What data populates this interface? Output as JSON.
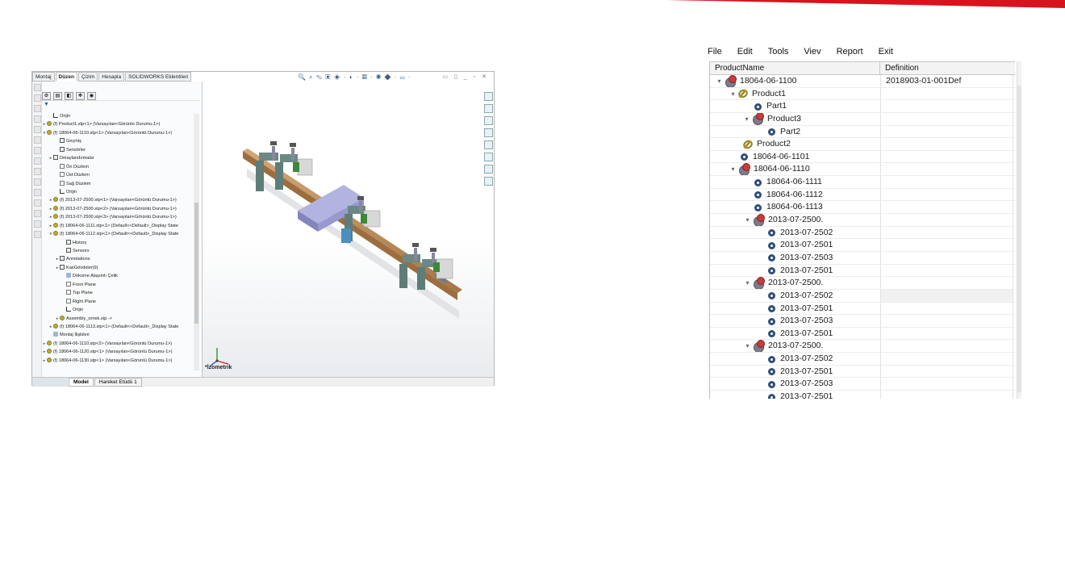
{
  "brand": {
    "accent_color": "#d7141e"
  },
  "solidworks": {
    "command_tabs": [
      "Montaj",
      "Düzen",
      "Çizim",
      "Hesapla",
      "SOLIDWORKS Eklentileri"
    ],
    "active_tab": "Düzen",
    "feature_tree": [
      {
        "text": "Orijin",
        "indent": 1,
        "icon": "origin",
        "arrow": ""
      },
      {
        "text": "(f) Product1.stp<1> (Varsayılan<Görüntü Durumu-1>)",
        "indent": 0,
        "icon": "assy",
        "arrow": "▸"
      },
      {
        "text": "(f) 18064-06-1110.stp<1> (Varsayılan<Görüntü Durumu-1>)",
        "indent": 0,
        "icon": "assy",
        "arrow": "▾"
      },
      {
        "text": "Geçmiş",
        "indent": 2,
        "icon": "folder",
        "arrow": ""
      },
      {
        "text": "Sensörler",
        "indent": 2,
        "icon": "folder",
        "arrow": ""
      },
      {
        "text": "Detaylandırmalar",
        "indent": 1,
        "icon": "folder",
        "arrow": "▸"
      },
      {
        "text": "Ön Düzlem",
        "indent": 2,
        "icon": "plane",
        "arrow": ""
      },
      {
        "text": "Üst Düzlem",
        "indent": 2,
        "icon": "plane",
        "arrow": ""
      },
      {
        "text": "Sağ Düzlem",
        "indent": 2,
        "icon": "plane",
        "arrow": ""
      },
      {
        "text": "Orijin",
        "indent": 2,
        "icon": "origin",
        "arrow": ""
      },
      {
        "text": "(f) 2013-07-2500.stp<1> (Varsayılan<Görüntü Durumu-1>)",
        "indent": 1,
        "icon": "assy",
        "arrow": "▸"
      },
      {
        "text": "(f) 2013-07-2500.stp<2> (Varsayılan<Görüntü Durumu-1>)",
        "indent": 1,
        "icon": "assy",
        "arrow": "▸"
      },
      {
        "text": "(f) 2013-07-2500.stp<3> (Varsayılan<Görüntü Durumu-1>)",
        "indent": 1,
        "icon": "assy",
        "arrow": "▸"
      },
      {
        "text": "(f) 18064-06-1111.stp<1> (Default<<Default>_Display State",
        "indent": 1,
        "icon": "assy",
        "arrow": "▸"
      },
      {
        "text": "(f) 18064-06-1112.stp<1> (Default<<Default>_Display State",
        "indent": 1,
        "icon": "assy",
        "arrow": "▾"
      },
      {
        "text": "History",
        "indent": 3,
        "icon": "folder",
        "arrow": ""
      },
      {
        "text": "Sensors",
        "indent": 3,
        "icon": "folder",
        "arrow": ""
      },
      {
        "text": "Annotations",
        "indent": 2,
        "icon": "folder",
        "arrow": "▸"
      },
      {
        "text": "KatıGövdeler(9)",
        "indent": 2,
        "icon": "folder",
        "arrow": "▸"
      },
      {
        "text": "Döküme Alaşımlı Çelik",
        "indent": 3,
        "icon": "mate",
        "arrow": ""
      },
      {
        "text": "Front Plane",
        "indent": 3,
        "icon": "plane",
        "arrow": ""
      },
      {
        "text": "Top Plane",
        "indent": 3,
        "icon": "plane",
        "arrow": ""
      },
      {
        "text": "Right Plane",
        "indent": 3,
        "icon": "plane",
        "arrow": ""
      },
      {
        "text": "Orijin",
        "indent": 3,
        "icon": "origin",
        "arrow": ""
      },
      {
        "text": "Assembly_ornek.stp ->",
        "indent": 2,
        "icon": "assy",
        "arrow": "▸"
      },
      {
        "text": "(f) 18064-06-1113.stp<1> (Default<<Default>_Display State",
        "indent": 1,
        "icon": "assy",
        "arrow": "▸"
      },
      {
        "text": "Montaj İlişkileri",
        "indent": 1,
        "icon": "mate",
        "arrow": ""
      },
      {
        "text": "(f) 18064-06-1110.stp<2> (Varsayılan<Görüntü Durumu-1>)",
        "indent": 0,
        "icon": "assy",
        "arrow": "▸"
      },
      {
        "text": "(f) 18064-06-1120.stp<1> (Varsayılan<Görüntü Durumu-1>)",
        "indent": 0,
        "icon": "assy",
        "arrow": "▸"
      },
      {
        "text": "(f) 18064-06-1130.stp<1> (Varsayılan<Görüntü Durumu-1>)",
        "indent": 0,
        "icon": "assy",
        "arrow": "▸"
      }
    ],
    "bottom_tabs": [
      "Model",
      "Hareket Etüdü 1"
    ],
    "view_orientation": "*İzometrik",
    "colors": {
      "rail": "#b98a55",
      "clamp": "#5f7d78",
      "plate": "#9a9ad2",
      "handle": "#3a8a3a"
    }
  },
  "product_tree": {
    "menu": [
      "File",
      "Edit",
      "Tools",
      "Viev",
      "Report",
      "Exit"
    ],
    "columns": [
      "ProductName",
      "Definition"
    ],
    "rows": [
      {
        "name": "18064-06-1100",
        "definition": "2018903-01-001Def",
        "level": 0,
        "icon": "assy",
        "expand": "▾"
      },
      {
        "name": "Product1",
        "definition": "",
        "level": 1,
        "icon": "prod",
        "expand": "▾"
      },
      {
        "name": "Part1",
        "definition": "",
        "level": 2,
        "icon": "part",
        "expand": ""
      },
      {
        "name": "Product3",
        "definition": "",
        "level": 2,
        "icon": "assy",
        "expand": "▾"
      },
      {
        "name": "Part2",
        "definition": "",
        "level": 3,
        "icon": "part",
        "expand": ""
      },
      {
        "name": "Product2",
        "definition": "",
        "level": 2,
        "icon": "prod",
        "expand": ""
      },
      {
        "name": "18064-06-1101",
        "definition": "",
        "level": 1,
        "icon": "part",
        "expand": ""
      },
      {
        "name": "18064-06-1110",
        "definition": "",
        "level": 0,
        "icon": "assy",
        "expand": "▾",
        "pad": "tight"
      },
      {
        "name": "18064-06-1111",
        "definition": "",
        "level": 2,
        "icon": "part",
        "expand": ""
      },
      {
        "name": "18064-06-1112",
        "definition": "",
        "level": 2,
        "icon": "part",
        "expand": ""
      },
      {
        "name": "18064-06-1113",
        "definition": "",
        "level": 2,
        "icon": "part",
        "expand": ""
      },
      {
        "name": "2013-07-2500.",
        "definition": "",
        "level": 2,
        "icon": "assy",
        "expand": "▾",
        "group": true
      },
      {
        "name": "2013-07-2502",
        "definition": "",
        "level": 3,
        "icon": "part",
        "expand": ""
      },
      {
        "name": "2013-07-2501",
        "definition": "",
        "level": 3,
        "icon": "part",
        "expand": ""
      },
      {
        "name": "2013-07-2503",
        "definition": "",
        "level": 3,
        "icon": "part",
        "expand": ""
      },
      {
        "name": "2013-07-2501",
        "definition": "",
        "level": 3,
        "icon": "part",
        "expand": ""
      },
      {
        "name": "2013-07-2500.",
        "definition": "",
        "level": 2,
        "icon": "assy",
        "expand": "▾",
        "group": true
      },
      {
        "name": "2013-07-2502",
        "definition": "",
        "level": 3,
        "icon": "part",
        "expand": "",
        "selected": true
      },
      {
        "name": "2013-07-2501",
        "definition": "",
        "level": 3,
        "icon": "part",
        "expand": ""
      },
      {
        "name": "2013-07-2503",
        "definition": "",
        "level": 3,
        "icon": "part",
        "expand": ""
      },
      {
        "name": "2013-07-2501",
        "definition": "",
        "level": 3,
        "icon": "part",
        "expand": ""
      },
      {
        "name": "2013-07-2500.",
        "definition": "",
        "level": 2,
        "icon": "assy",
        "expand": "▾",
        "group": true
      },
      {
        "name": "2013-07-2502",
        "definition": "",
        "level": 3,
        "icon": "part",
        "expand": ""
      },
      {
        "name": "2013-07-2501",
        "definition": "",
        "level": 3,
        "icon": "part",
        "expand": ""
      },
      {
        "name": "2013-07-2503",
        "definition": "",
        "level": 3,
        "icon": "part",
        "expand": ""
      },
      {
        "name": "2013-07-2501",
        "definition": "",
        "level": 3,
        "icon": "part",
        "expand": ""
      }
    ]
  }
}
